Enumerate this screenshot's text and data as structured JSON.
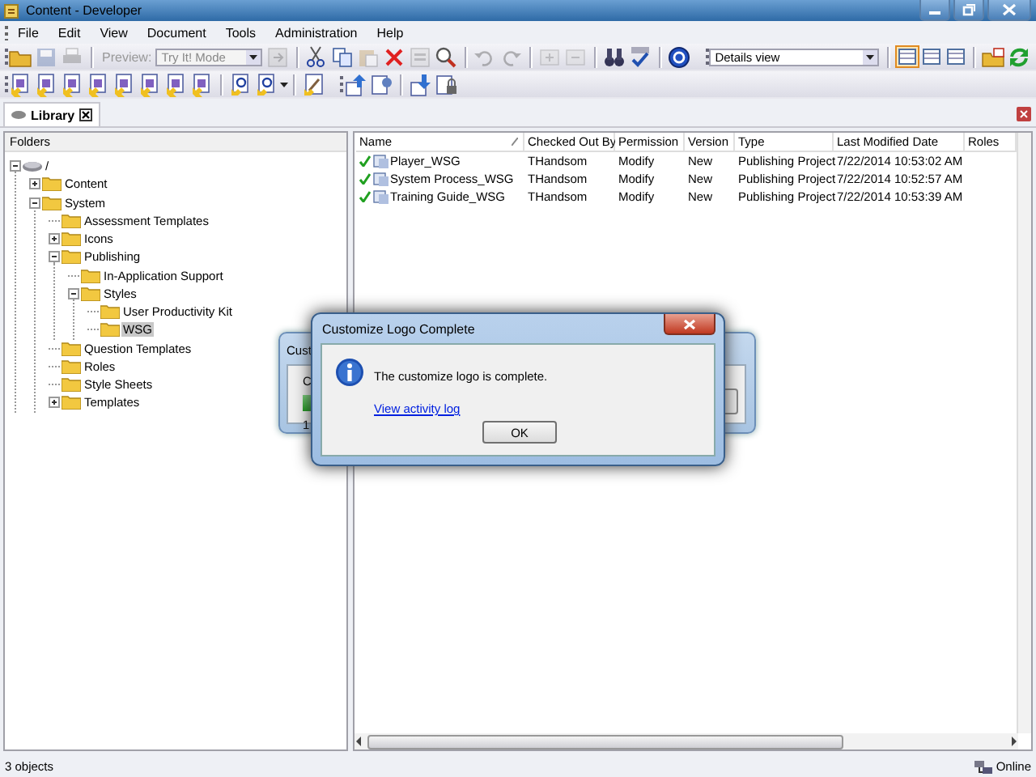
{
  "window": {
    "title": "Content - Developer"
  },
  "menu": [
    "File",
    "Edit",
    "View",
    "Document",
    "Tools",
    "Administration",
    "Help"
  ],
  "toolbar_1": [
    {
      "kind": "grip"
    },
    {
      "kind": "folder",
      "disabled": false
    },
    {
      "kind": "save",
      "disabled": true
    },
    {
      "kind": "print",
      "disabled": true
    },
    {
      "kind": "separator"
    },
    {
      "kind": "label",
      "text": "Preview:",
      "disabled": true
    },
    {
      "kind": "combo",
      "text": "Try It! Mode",
      "disabled": true
    },
    {
      "kind": "go",
      "disabled": true
    },
    {
      "kind": "separator"
    },
    {
      "kind": "cut",
      "disabled": false
    },
    {
      "kind": "copy",
      "disabled": false
    },
    {
      "kind": "paste",
      "disabled": true
    },
    {
      "kind": "delete",
      "disabled": false
    },
    {
      "kind": "properties",
      "disabled": true
    },
    {
      "kind": "find",
      "disabled": false
    },
    {
      "kind": "separator"
    },
    {
      "kind": "undo",
      "disabled": true
    },
    {
      "kind": "redo",
      "disabled": true
    },
    {
      "kind": "separator"
    },
    {
      "kind": "plus",
      "disabled": true
    },
    {
      "kind": "minus",
      "disabled": true
    },
    {
      "kind": "separator"
    },
    {
      "kind": "binoculars",
      "disabled": false
    },
    {
      "kind": "spellcheck",
      "disabled": false
    },
    {
      "kind": "separator"
    },
    {
      "kind": "help",
      "disabled": false
    },
    {
      "kind": "gap"
    },
    {
      "kind": "grip"
    },
    {
      "kind": "combo",
      "text": "Details view",
      "disabled": false
    },
    {
      "kind": "separator"
    },
    {
      "kind": "view",
      "selected": true
    },
    {
      "kind": "view",
      "selected": false
    },
    {
      "kind": "view",
      "selected": false
    },
    {
      "kind": "separator"
    },
    {
      "kind": "folderprops",
      "disabled": false
    },
    {
      "kind": "refresh",
      "disabled": false
    }
  ],
  "toolbar_2": [
    {
      "kind": "grip"
    },
    {
      "kind": "newdoc",
      "disabled": false
    },
    {
      "kind": "newdoc",
      "disabled": false
    },
    {
      "kind": "newdoc",
      "disabled": false
    },
    {
      "kind": "newdoc",
      "disabled": false
    },
    {
      "kind": "newdoc",
      "disabled": false
    },
    {
      "kind": "newdoc",
      "disabled": false
    },
    {
      "kind": "newdoc",
      "disabled": false
    },
    {
      "kind": "newdoc",
      "disabled": false
    },
    {
      "kind": "separator"
    },
    {
      "kind": "question",
      "disabled": false
    },
    {
      "kind": "question",
      "disabled": false
    },
    {
      "kind": "caret"
    },
    {
      "kind": "separator"
    },
    {
      "kind": "edit",
      "disabled": false
    },
    {
      "kind": "gap"
    },
    {
      "kind": "grip"
    },
    {
      "kind": "upload",
      "disabled": false
    },
    {
      "kind": "link",
      "disabled": false
    },
    {
      "kind": "separator"
    },
    {
      "kind": "download",
      "disabled": false
    },
    {
      "kind": "lock",
      "disabled": false
    }
  ],
  "tabs": [
    {
      "label": "Library",
      "selected": true
    }
  ],
  "folders": {
    "header": "Folders",
    "tree": [
      {
        "label": "/",
        "kind": "drive",
        "expanded": true,
        "selected": false,
        "children": [
          {
            "label": "Content",
            "kind": "folder",
            "expanded": false,
            "selected": false
          },
          {
            "label": "System",
            "kind": "folder",
            "expanded": true,
            "selected": false,
            "children": [
              {
                "label": "Assessment Templates",
                "kind": "folder",
                "selected": false
              },
              {
                "label": "Icons",
                "kind": "folder",
                "expanded": false,
                "selected": false
              },
              {
                "label": "Publishing",
                "kind": "folder",
                "expanded": true,
                "selected": false,
                "children": [
                  {
                    "label": "In-Application Support",
                    "kind": "folder",
                    "selected": false
                  },
                  {
                    "label": "Styles",
                    "kind": "folder",
                    "expanded": true,
                    "selected": false,
                    "children": [
                      {
                        "label": "User Productivity Kit",
                        "kind": "folder",
                        "selected": false
                      },
                      {
                        "label": "WSG",
                        "kind": "folder",
                        "selected": true
                      }
                    ]
                  }
                ]
              },
              {
                "label": "Question Templates",
                "kind": "folder",
                "selected": false
              },
              {
                "label": "Roles",
                "kind": "folder",
                "selected": false
              },
              {
                "label": "Style Sheets",
                "kind": "folder",
                "selected": false
              },
              {
                "label": "Templates",
                "kind": "folder",
                "expanded": false,
                "selected": false
              }
            ]
          }
        ]
      }
    ]
  },
  "table": {
    "columns": [
      {
        "label": "Name",
        "sorted": true
      },
      {
        "label": "Checked Out By",
        "sorted": false
      },
      {
        "label": "Permission",
        "sorted": false
      },
      {
        "label": "Version",
        "sorted": false
      },
      {
        "label": "Type",
        "sorted": false
      },
      {
        "label": "Last Modified Date",
        "sorted": false
      },
      {
        "label": "Roles",
        "sorted": false
      }
    ],
    "rows": [
      [
        "Player_WSG",
        "THandsom",
        "Modify",
        "New",
        "Publishing Project",
        "7/22/2014 10:53:02 AM"
      ],
      [
        "System Process_WSG",
        "THandsom",
        "Modify",
        "New",
        "Publishing Project",
        "7/22/2014 10:52:57 AM"
      ],
      [
        "Training Guide_WSG",
        "THandsom",
        "Modify",
        "New",
        "Publishing Project",
        "7/22/2014 10:53:39 AM"
      ]
    ]
  },
  "back_dialog": {
    "title": "Cust",
    "label": "C",
    "level": 0.2,
    "count": "1"
  },
  "dialog": {
    "title": "Customize Logo Complete",
    "message": "The customize logo is complete.",
    "link": "View activity log",
    "button": "OK"
  },
  "status_bar": {
    "count": "3 objects",
    "connection": "Online"
  }
}
